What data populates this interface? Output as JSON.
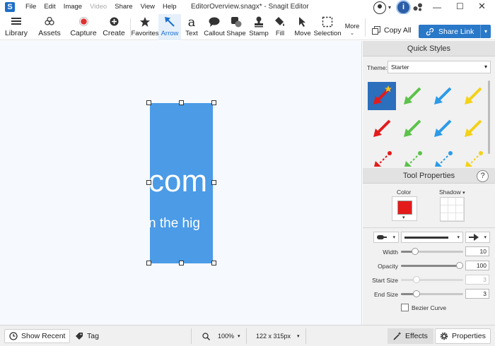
{
  "app": {
    "logo_letter": "S",
    "window_title": "EditorOverview.snagx* - Snagit Editor",
    "menu": [
      "File",
      "Edit",
      "Image",
      "Video",
      "Share",
      "View",
      "Help"
    ],
    "menu_disabled": [
      "Video"
    ]
  },
  "toolbar": {
    "library": "Library",
    "assets": "Assets",
    "capture": "Capture",
    "create": "Create",
    "tools": [
      {
        "label": "Favorites",
        "icon": "star-icon"
      },
      {
        "label": "Arrow",
        "icon": "arrow-icon",
        "active": true
      },
      {
        "label": "Text",
        "icon": "text-icon"
      },
      {
        "label": "Callout",
        "icon": "callout-icon"
      },
      {
        "label": "Shape",
        "icon": "shape-icon"
      },
      {
        "label": "Stamp",
        "icon": "stamp-icon"
      },
      {
        "label": "Fill",
        "icon": "fill-icon"
      },
      {
        "label": "Move",
        "icon": "move-icon"
      },
      {
        "label": "Selection",
        "icon": "selection-icon"
      }
    ],
    "more": "More",
    "copy_all": "Copy All",
    "share_link": "Share Link"
  },
  "canvas": {
    "image_text_big": "com",
    "image_text_small": "n the hig",
    "image_color": "#4b9be7"
  },
  "quick_styles": {
    "title": "Quick Styles",
    "theme_label": "Theme:",
    "theme_value": "Starter",
    "arrow_colors": [
      "#e31b1b",
      "#5cc24a",
      "#2b9be8",
      "#f3d218"
    ]
  },
  "tool_properties": {
    "title": "Tool Properties",
    "help": "?",
    "color_label": "Color",
    "color_value": "#e31b1b",
    "shadow_label": "Shadow",
    "width_label": "Width",
    "width_value": "10",
    "opacity_label": "Opacity",
    "opacity_value": "100",
    "start_size_label": "Start Size",
    "start_size_value": "3",
    "end_size_label": "End Size",
    "end_size_value": "3",
    "bezier_label": "Bezier Curve"
  },
  "statusbar": {
    "show_recent": "Show Recent",
    "tag": "Tag",
    "zoom": "100%",
    "dimensions": "122 x 315px",
    "effects": "Effects",
    "properties": "Properties"
  }
}
